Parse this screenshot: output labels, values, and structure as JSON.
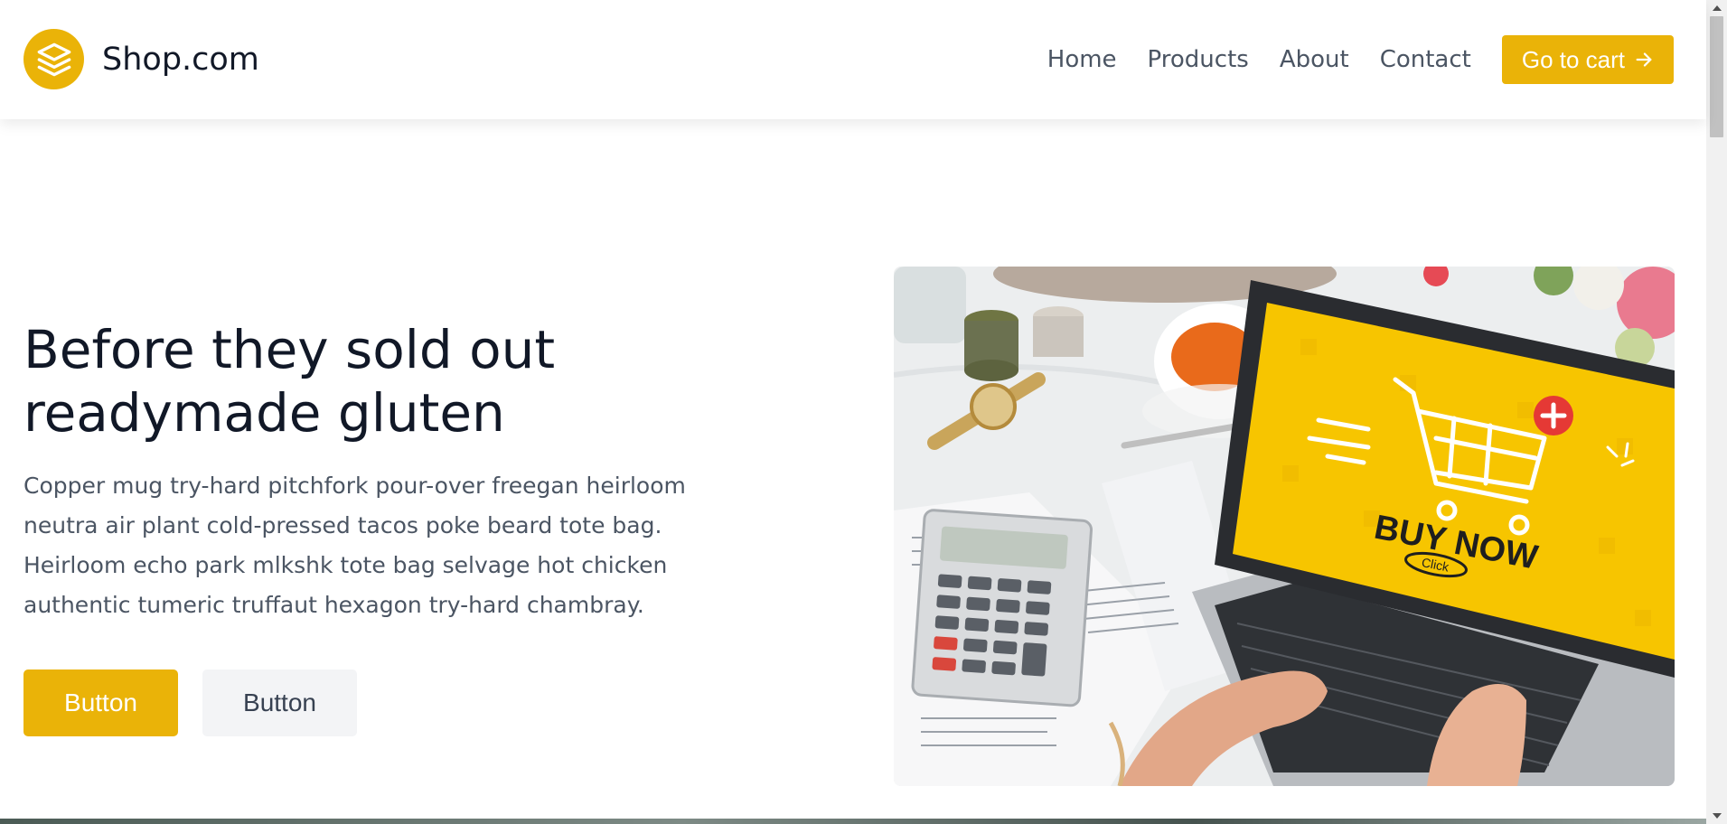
{
  "header": {
    "brand_name": "Shop.com",
    "logo_icon": "stack-layers-icon",
    "nav": [
      "Home",
      "Products",
      "About",
      "Contact"
    ],
    "cart_label": "Go to cart",
    "cart_icon": "arrow-right-icon"
  },
  "hero": {
    "title_line1": "Before they sold out",
    "title_line2": "readymade gluten",
    "description": "Copper mug try-hard pitchfork pour-over freegan heirloom neutra air plant cold-pressed tacos poke beard tote bag. Heirloom echo park mlkshk tote bag selvage hot chicken authentic tumeric truffaut hexagon try-hard chambray.",
    "primary_button": "Button",
    "secondary_button": "Button",
    "image": {
      "screen_text": "BUY NOW",
      "button_text": "Click"
    }
  },
  "colors": {
    "accent": "#eab308",
    "heading": "#111827",
    "body_text": "#4b5563",
    "secondary_bg": "#f3f4f6"
  }
}
